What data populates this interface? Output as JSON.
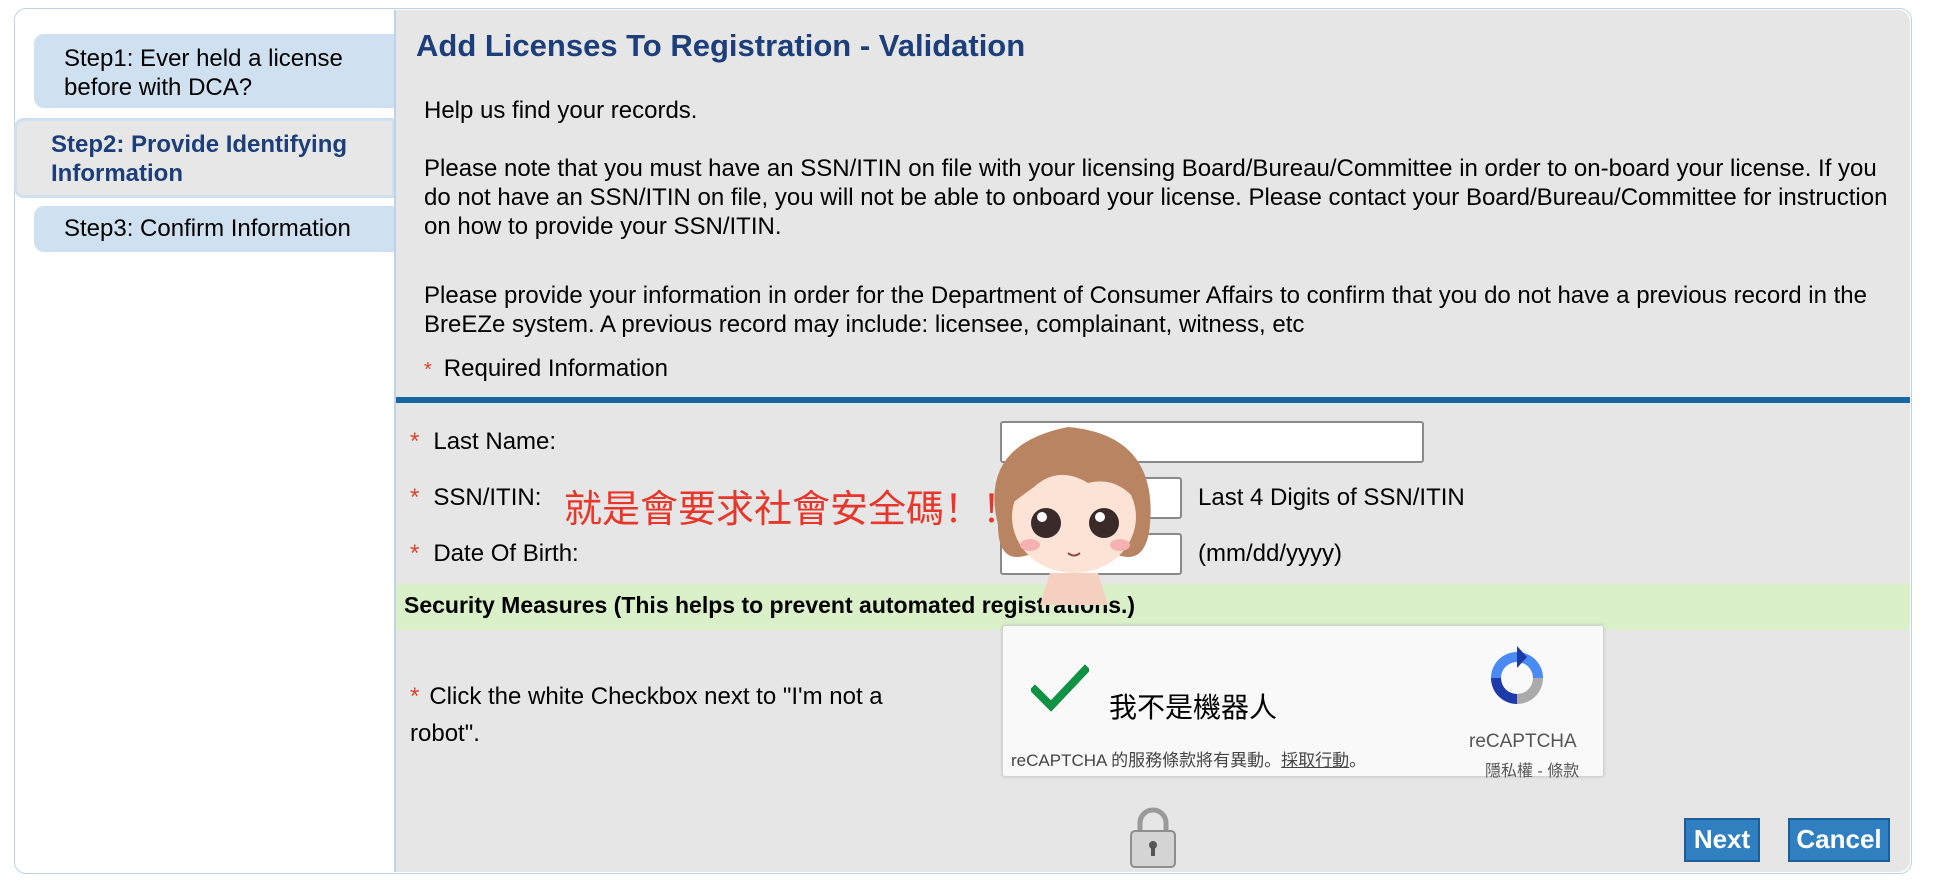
{
  "steps": [
    {
      "label": "Step1: Ever held a license before with DCA?"
    },
    {
      "label": "Step2: Provide Identifying Information"
    },
    {
      "label": "Step3: Confirm Information"
    }
  ],
  "page": {
    "title": "Add Licenses To Registration - Validation",
    "intro": "Help us find your records.",
    "note": "Please note that you must have an SSN/ITIN on file with your licensing Board/Bureau/Committee in order to on-board your license. If you do not have an SSN/ITIN on file, you will not be able to onboard your license. Please contact your Board/Bureau/Committee for instruction on how to provide your SSN/ITIN.",
    "provide": "Please provide your information in order for the Department of Consumer Affairs to confirm that you do not have a previous record in the BreEZe system. A previous record may include: licensee, complainant, witness, etc",
    "required_label": "Required Information",
    "required_mark": "*"
  },
  "form": {
    "last_name_label": "Last Name:",
    "last_name_value": "",
    "ssn_label": "SSN/ITIN:",
    "ssn_hint": "Last 4 Digits of SSN/ITIN",
    "dob_label": "Date Of Birth:",
    "dob_hint": "(mm/dd/yyyy)"
  },
  "overlay_text": "就是會要求社會安全碼！！！",
  "security": {
    "title": "Security Measures",
    "subtitle": "(This helps to prevent automated registrations.)",
    "robot_instruction": "Click the white Checkbox next to \"I'm not a robot\"."
  },
  "captcha": {
    "checkbox_label": "我不是機器人",
    "terms_prefix": "reCAPTCHA 的服務條款將有異動。",
    "terms_link": "採取行動",
    "terms_suffix": "。",
    "brand": "reCAPTCHA",
    "privacy_terms": "隱私權 - 條款",
    "checked": true
  },
  "buttons": {
    "next": "Next",
    "cancel": "Cancel"
  },
  "colors": {
    "title": "#1c3f7c",
    "accent_bar": "#1767a5",
    "required_star": "#d9452b",
    "button": "#2f7fc1",
    "security_bar": "#d9f0c9"
  }
}
